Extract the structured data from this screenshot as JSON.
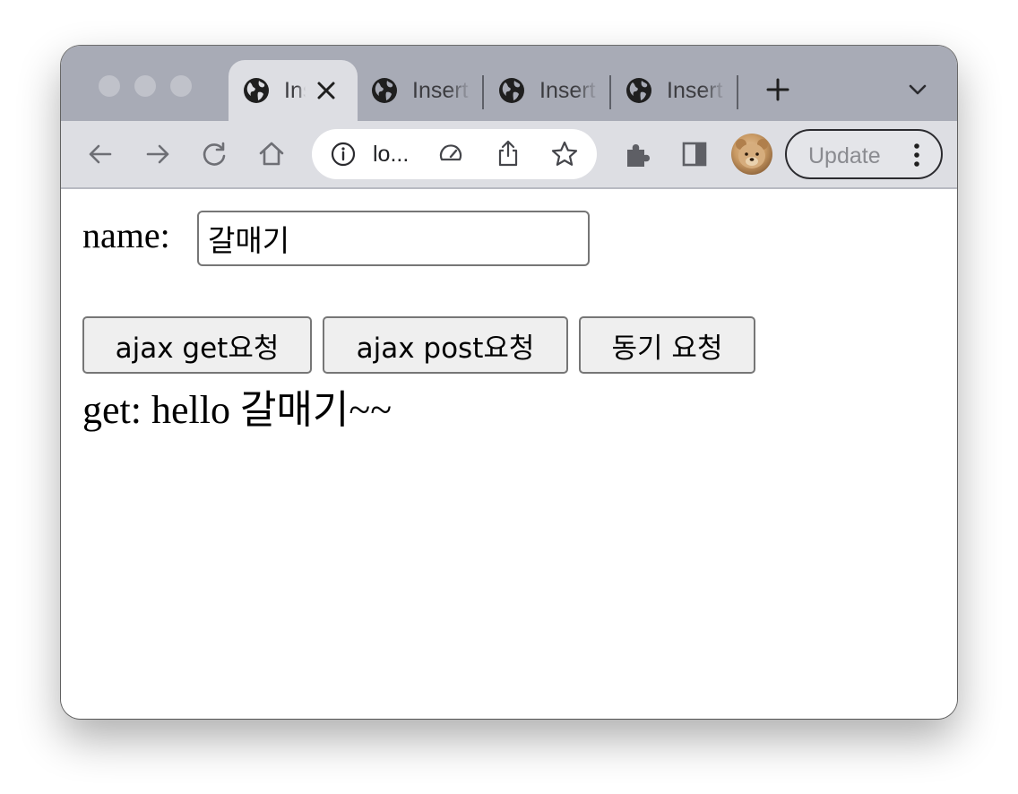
{
  "browser": {
    "tabs": [
      {
        "title": "Insert",
        "active": true
      },
      {
        "title": "Insert",
        "active": false
      },
      {
        "title": "Insert",
        "active": false
      },
      {
        "title": "Insert",
        "active": false
      }
    ],
    "address_bar": {
      "text": "lo..."
    },
    "update_label": "Update",
    "icons": {
      "tab_favicon": "globe-icon",
      "tab_close": "close-icon",
      "new_tab": "plus-icon",
      "tab_search": "chevron-down-icon",
      "back": "arrow-left-icon",
      "forward": "arrow-right-icon",
      "reload": "reload-icon",
      "home": "home-icon",
      "site_info": "info-icon",
      "performance": "speedometer-icon",
      "share": "share-icon",
      "bookmark": "star-icon",
      "extensions": "puzzle-icon",
      "side_panel": "side-panel-icon",
      "menu": "kebab-menu-icon"
    }
  },
  "page": {
    "name_label": "name:",
    "name_value": "갈매기",
    "buttons": {
      "ajax_get": "ajax get요청",
      "ajax_post": "ajax post요청",
      "sync": "동기 요청"
    },
    "result_text": "get: hello 갈매기~~"
  }
}
